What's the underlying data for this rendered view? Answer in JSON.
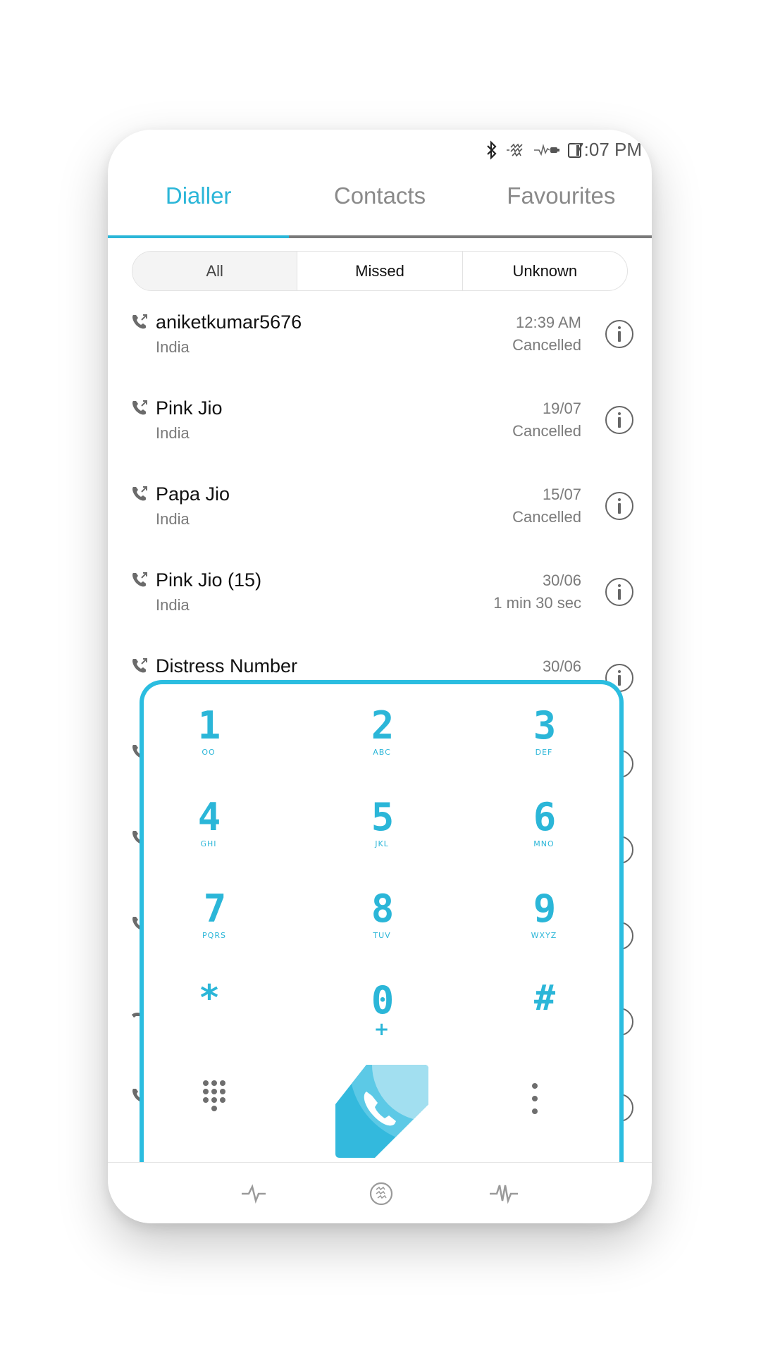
{
  "status_bar": {
    "time": "7:07 PM",
    "icons": [
      "bluetooth-icon",
      "vibrate-icon",
      "charging-icon",
      "battery-icon"
    ]
  },
  "tabs": [
    {
      "label": "Dialler",
      "active": true
    },
    {
      "label": "Contacts",
      "active": false
    },
    {
      "label": "Favourites",
      "active": false
    }
  ],
  "filter": {
    "options": [
      "All",
      "Missed",
      "Unknown"
    ],
    "selected": "All"
  },
  "call_log": [
    {
      "name": "aniketkumar5676",
      "location": "India",
      "when": "12:39 AM",
      "status": "Cancelled",
      "type": "outgoing"
    },
    {
      "name": "Pink Jio",
      "location": "India",
      "when": "19/07",
      "status": "Cancelled",
      "type": "outgoing"
    },
    {
      "name": "Papa Jio",
      "location": "India",
      "when": "15/07",
      "status": "Cancelled",
      "type": "outgoing"
    },
    {
      "name": "Pink Jio  (15)",
      "location": "India",
      "when": "30/06",
      "status": "1 min 30 sec",
      "type": "outgoing"
    },
    {
      "name": "Distress Number",
      "location": "",
      "when": "30/06",
      "status": "",
      "type": "outgoing"
    }
  ],
  "dialpad": {
    "keys": [
      {
        "digit": "1",
        "letters": "OO"
      },
      {
        "digit": "2",
        "letters": "ABC"
      },
      {
        "digit": "3",
        "letters": "DEF"
      },
      {
        "digit": "4",
        "letters": "GHI"
      },
      {
        "digit": "5",
        "letters": "JKL"
      },
      {
        "digit": "6",
        "letters": "MNO"
      },
      {
        "digit": "7",
        "letters": "PQRS"
      },
      {
        "digit": "8",
        "letters": "TUV"
      },
      {
        "digit": "9",
        "letters": "WXYZ"
      },
      {
        "digit": "*",
        "letters": ""
      },
      {
        "digit": "0",
        "letters": "+"
      },
      {
        "digit": "#",
        "letters": ""
      }
    ],
    "left_action": "dialpad-toggle-icon",
    "center_action": "call-icon",
    "right_action": "more-options-icon"
  },
  "bottom_nav": [
    "pulse-icon",
    "vibration-icon",
    "waveform-icon"
  ],
  "colors": {
    "accent": "#2bb6d8",
    "pad_border": "#2bbde0",
    "call_dark": "#33b9dd",
    "call_mid": "#5cc9e6",
    "call_light": "#a2dff0",
    "text_secondary": "#7b7b7b"
  }
}
